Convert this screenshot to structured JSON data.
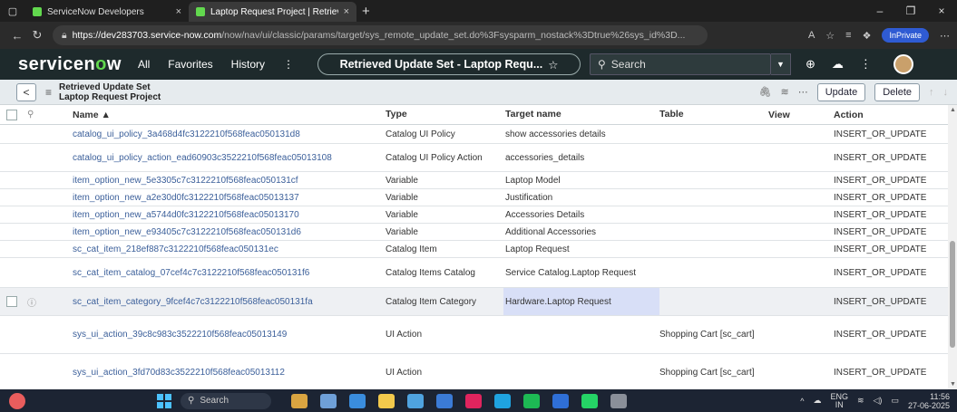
{
  "browser": {
    "tabs": [
      {
        "title": "ServiceNow Developers",
        "close": "×"
      },
      {
        "title": "Laptop Request Project | Retrieve",
        "close": "×"
      }
    ],
    "new_tab": "+",
    "window_controls": {
      "minimize": "–",
      "restore": "❐",
      "close": "×"
    },
    "url_host": "https://dev283703.service-now.com",
    "url_path": "/now/nav/ui/classic/params/target/sys_remote_update_set.do%3Fsysparm_nostack%3Dtrue%26sys_id%3D...",
    "inprivate": "InPrivate"
  },
  "header": {
    "logo_a": "servicen",
    "logo_o": "o",
    "logo_b": "w",
    "menu": [
      "All",
      "Favorites",
      "History",
      "⋮"
    ],
    "context_title": "Retrieved Update Set - Laptop Requ...",
    "search_placeholder": "Search"
  },
  "form": {
    "title_line1": "Retrieved Update Set",
    "title_line2": "Laptop Request Project",
    "update_label": "Update",
    "delete_label": "Delete"
  },
  "columns": {
    "name": "Name ▲",
    "type": "Type",
    "target": "Target name",
    "table": "Table",
    "view": "View",
    "action": "Action"
  },
  "rows": [
    {
      "name": "catalog_ui_policy_3a468d4fc3122210f568feac050131d8",
      "type": "Catalog UI Policy",
      "target": "show accessories details",
      "table": "",
      "view": "",
      "action": "INSERT_OR_UPDATE"
    },
    {
      "name": "catalog_ui_policy_action_ead60903c3522210f568feac05013108",
      "type": "Catalog UI Policy Action",
      "target": "accessories_details",
      "table": "",
      "view": "",
      "action": "INSERT_OR_UPDATE"
    },
    {
      "name": "item_option_new_5e3305c7c3122210f568feac050131cf",
      "type": "Variable",
      "target": "Laptop Model",
      "table": "",
      "view": "",
      "action": "INSERT_OR_UPDATE"
    },
    {
      "name": "item_option_new_a2e30d0fc3122210f568feac05013137",
      "type": "Variable",
      "target": "Justification",
      "table": "",
      "view": "",
      "action": "INSERT_OR_UPDATE"
    },
    {
      "name": "item_option_new_a5744d0fc3122210f568feac05013170",
      "type": "Variable",
      "target": "Accessories Details",
      "table": "",
      "view": "",
      "action": "INSERT_OR_UPDATE"
    },
    {
      "name": "item_option_new_e93405c7c3122210f568feac050131d6",
      "type": "Variable",
      "target": "Additional Accessories",
      "table": "",
      "view": "",
      "action": "INSERT_OR_UPDATE"
    },
    {
      "name": "sc_cat_item_218ef887c3122210f568feac050131ec",
      "type": "Catalog Item",
      "target": "Laptop Request",
      "table": "",
      "view": "",
      "action": "INSERT_OR_UPDATE"
    },
    {
      "name": "sc_cat_item_catalog_07cef4c7c3122210f568feac050131f6",
      "type": "Catalog Items Catalog",
      "target": "Service Catalog.Laptop Request",
      "table": "",
      "view": "",
      "action": "INSERT_OR_UPDATE"
    },
    {
      "name": "sc_cat_item_category_9fcef4c7c3122210f568feac050131fa",
      "type": "Catalog Item Category",
      "target": "Hardware.Laptop Request",
      "table": "",
      "view": "",
      "action": "INSERT_OR_UPDATE"
    },
    {
      "name": "sys_ui_action_39c8c983c3522210f568feac05013149",
      "type": "UI Action",
      "target": "",
      "table": "Shopping Cart [sc_cart]",
      "view": "",
      "action": "INSERT_OR_UPDATE"
    },
    {
      "name": "sys_ui_action_3fd70d83c3522210f568feac05013112",
      "type": "UI Action",
      "target": "",
      "table": "Shopping Cart [sc_cart]",
      "view": "",
      "action": "INSERT_OR_UPDATE"
    }
  ],
  "taskbar": {
    "search_label": "Search",
    "lang_line1": "ENG",
    "lang_line2": "IN",
    "time": "11:56",
    "date": "27-06-2025"
  },
  "colors": {
    "accent_green": "#62d84e",
    "header_bg": "#1e2a2c",
    "link": "#3b5f9a"
  }
}
